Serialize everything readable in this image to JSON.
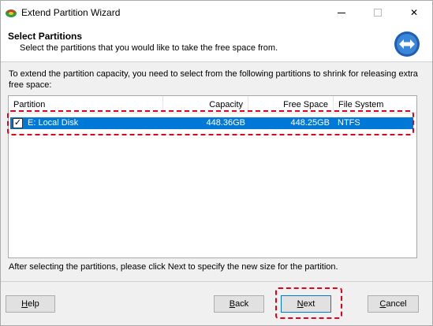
{
  "window": {
    "title": "Extend Partition Wizard",
    "controls": {
      "minimize": "—",
      "maximize": "☐",
      "close": "✕"
    }
  },
  "header": {
    "title": "Select Partitions",
    "subtitle": "Select the partitions that you would like to take the free space from.",
    "icon": "extend-arrows-icon"
  },
  "instructions": "To extend the partition capacity, you need to select from the following partitions to shrink for releasing extra free space:",
  "partition_list": {
    "columns": [
      "Partition",
      "Capacity",
      "Free Space",
      "File System"
    ],
    "rows": [
      {
        "checked": true,
        "check_glyph": "✓",
        "name": "E: Local Disk",
        "capacity": "448.36GB",
        "free_space": "448.25GB",
        "file_system": "NTFS",
        "selected": true
      }
    ]
  },
  "footer_text": "After selecting the partitions, please click Next to specify the new size for the partition.",
  "buttons": {
    "help": {
      "label_first": "H",
      "label_rest": "elp"
    },
    "back": {
      "label_first": "B",
      "label_rest": "ack"
    },
    "next": {
      "label_first": "N",
      "label_rest": "ext"
    },
    "cancel": {
      "label_first": "C",
      "label_rest": "ancel"
    }
  },
  "colors": {
    "selection": "#0078d7",
    "highlight": "#e0001b",
    "button_face": "#e1e1e1",
    "dialog_bg": "#f0f0f0"
  }
}
